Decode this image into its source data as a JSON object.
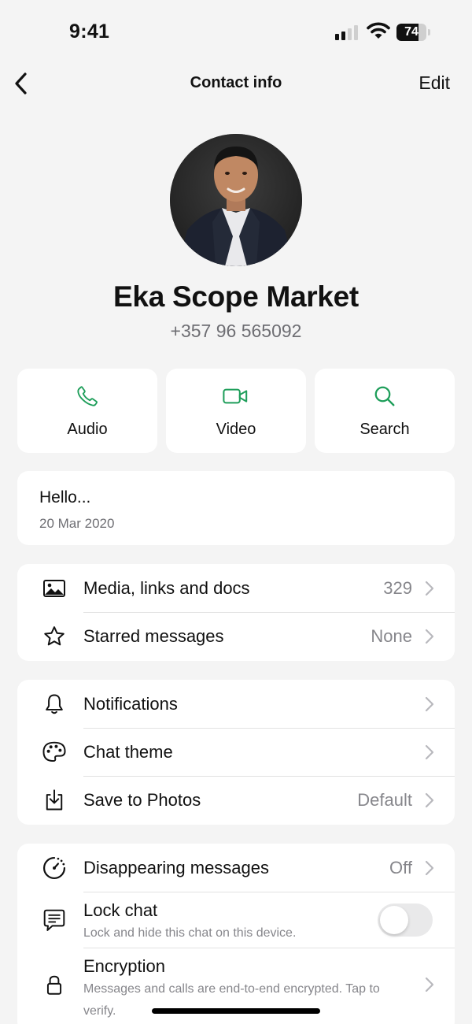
{
  "status_bar": {
    "time": "9:41",
    "battery": "74",
    "battery_level": 0.74
  },
  "nav": {
    "title": "Contact info",
    "edit_label": "Edit"
  },
  "contact": {
    "name": "Eka Scope Market",
    "phone": "+357 96 565092"
  },
  "actions": [
    {
      "label": "Audio",
      "icon": "phone-icon"
    },
    {
      "label": "Video",
      "icon": "video-icon"
    },
    {
      "label": "Search",
      "icon": "search-icon"
    }
  ],
  "about": {
    "text": "Hello...",
    "date": "20 Mar 2020"
  },
  "group1": {
    "media": {
      "label": "Media, links and docs",
      "value": "329",
      "icon": "image-icon"
    },
    "starred": {
      "label": "Starred messages",
      "value": "None",
      "icon": "star-icon"
    }
  },
  "group2": {
    "notifications": {
      "label": "Notifications",
      "icon": "bell-icon"
    },
    "chat_theme": {
      "label": "Chat theme",
      "icon": "palette-icon"
    },
    "save_photos": {
      "label": "Save to Photos",
      "value": "Default",
      "icon": "download-icon"
    }
  },
  "group3": {
    "disappearing": {
      "label": "Disappearing messages",
      "value": "Off",
      "icon": "timer-icon"
    },
    "lock_chat": {
      "label": "Lock chat",
      "sublabel": "Lock and hide this chat on this device.",
      "enabled": false,
      "icon": "chat-lock-icon"
    },
    "encryption": {
      "label": "Encryption",
      "sublabel": "Messages and calls are end-to-end encrypted. Tap to verify.",
      "icon": "lock-icon"
    }
  },
  "colors": {
    "accent": "#1e9e5a",
    "background": "#f4f4f4",
    "card": "#ffffff",
    "secondary_text": "#86868b"
  }
}
